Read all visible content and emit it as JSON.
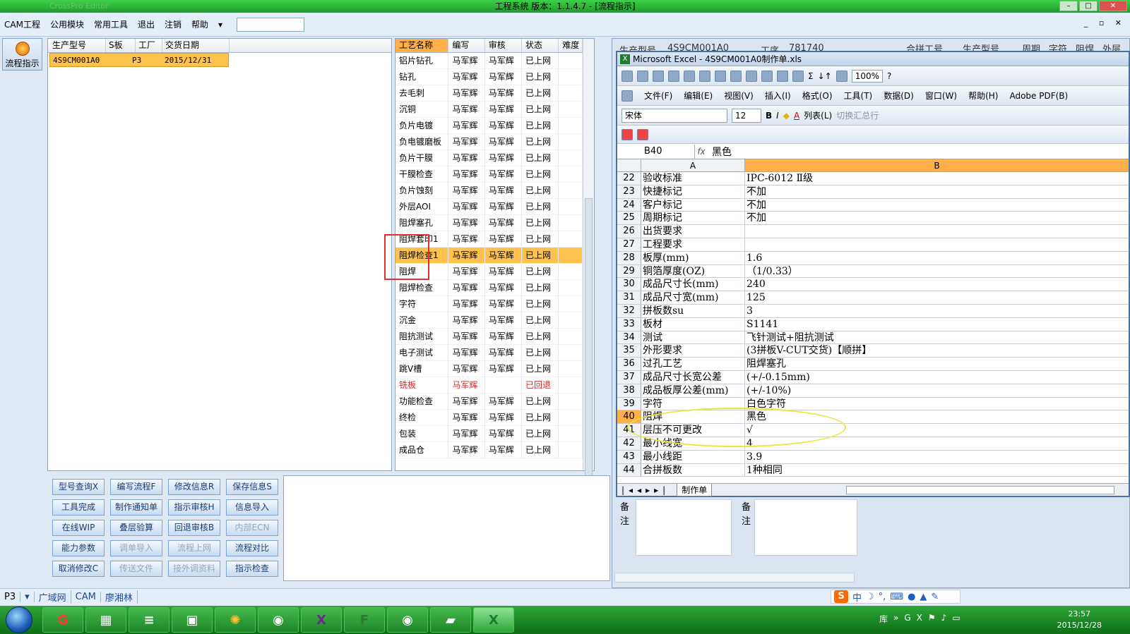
{
  "window": {
    "title": "工程系统   版本：1.1.4.7 - [流程指示]"
  },
  "menu": {
    "items": [
      "CAM工程",
      "公用模块",
      "常用工具",
      "退出",
      "注销",
      "帮助"
    ]
  },
  "flow_button": {
    "label": "流程指示"
  },
  "left_table": {
    "headers": [
      "生产型号",
      "S板",
      "工厂",
      "交货日期"
    ],
    "rows": [
      [
        "4S9CM001A0",
        "",
        "P3",
        "2015/12/31"
      ]
    ]
  },
  "process_table": {
    "headers": [
      "工艺名称",
      "编写",
      "审核",
      "状态",
      "难度"
    ],
    "rows": [
      [
        "铝片钻孔",
        "马军辉",
        "马军辉",
        "已上网",
        ""
      ],
      [
        "钻孔",
        "马军辉",
        "马军辉",
        "已上网",
        ""
      ],
      [
        "去毛刺",
        "马军辉",
        "马军辉",
        "已上网",
        ""
      ],
      [
        "沉铜",
        "马军辉",
        "马军辉",
        "已上网",
        ""
      ],
      [
        "负片电镀",
        "马军辉",
        "马军辉",
        "已上网",
        ""
      ],
      [
        "负电镀磨板",
        "马军辉",
        "马军辉",
        "已上网",
        ""
      ],
      [
        "负片干膜",
        "马军辉",
        "马军辉",
        "已上网",
        ""
      ],
      [
        "干膜检查",
        "马军辉",
        "马军辉",
        "已上网",
        ""
      ],
      [
        "负片蚀刻",
        "马军辉",
        "马军辉",
        "已上网",
        ""
      ],
      [
        "外层AOI",
        "马军辉",
        "马军辉",
        "已上网",
        ""
      ],
      [
        "阻焊塞孔",
        "马军辉",
        "马军辉",
        "已上网",
        ""
      ],
      [
        "阻焊套印1",
        "马军辉",
        "马军辉",
        "已上网",
        ""
      ],
      [
        "阻焊检查1",
        "马军辉",
        "马军辉",
        "已上网",
        ""
      ],
      [
        "阻焊",
        "马军辉",
        "马军辉",
        "已上网",
        ""
      ],
      [
        "阻焊检查",
        "马军辉",
        "马军辉",
        "已上网",
        ""
      ],
      [
        "字符",
        "马军辉",
        "马军辉",
        "已上网",
        ""
      ],
      [
        "沉金",
        "马军辉",
        "马军辉",
        "已上网",
        ""
      ],
      [
        "阻抗测试",
        "马军辉",
        "马军辉",
        "已上网",
        ""
      ],
      [
        "电子测试",
        "马军辉",
        "马军辉",
        "已上网",
        ""
      ],
      [
        "跳V槽",
        "马军辉",
        "马军辉",
        "已上网",
        ""
      ],
      [
        "铣板",
        "马军辉",
        "",
        "已回退",
        ""
      ],
      [
        "功能检查",
        "马军辉",
        "马军辉",
        "已上网",
        ""
      ],
      [
        "终检",
        "马军辉",
        "马军辉",
        "已上网",
        ""
      ],
      [
        "包装",
        "马军辉",
        "马军辉",
        "已上网",
        ""
      ],
      [
        "成品仓",
        "马军辉",
        "马军辉",
        "已上网",
        ""
      ]
    ]
  },
  "buttons": [
    [
      "型号查询X",
      "编写流程F",
      "修改信息R",
      "保存信息S"
    ],
    [
      "工具完成",
      "制作通知单",
      "指示审核H",
      "信息导入"
    ],
    [
      "在线WIP",
      "叠层验算",
      "回退审核B",
      "内部ECN"
    ],
    [
      "能力参数",
      "调单导入",
      "流程上网",
      "流程对比"
    ],
    [
      "取消修改C",
      "传送文件",
      "接外调资料",
      "指示检查"
    ]
  ],
  "status_bar": {
    "combo": "P3",
    "items": [
      "广域网",
      "CAM",
      "廖湘林"
    ]
  },
  "bg_window": {
    "labels": [
      "生产型号",
      "4S9CM001A0",
      "工序",
      "781740",
      "合拼工号",
      "生产型号",
      "周期",
      "字符",
      "阻焊",
      "外层"
    ],
    "note_label_1": "备注",
    "note_label_2": "备注"
  },
  "excel": {
    "title": "Microsoft Excel - 4S9CM001A0制作单.xls",
    "menu": [
      "文件(F)",
      "编辑(E)",
      "视图(V)",
      "插入(I)",
      "格式(O)",
      "工具(T)",
      "数据(D)",
      "窗口(W)",
      "帮助(H)",
      "Adobe PDF(B)"
    ],
    "zoom": "100%",
    "font": "宋体",
    "font_size": "12",
    "toolbar_items": [
      "列表(L)",
      "切换汇总行"
    ],
    "name_box": "B40",
    "formula_value": "黑色",
    "col_a": "A",
    "col_b": "B",
    "sheet_tab": "制作单",
    "rows": [
      [
        "22",
        "验收标准",
        "IPC-6012 Ⅱ级"
      ],
      [
        "23",
        "快捷标记",
        "不加"
      ],
      [
        "24",
        "客户标记",
        "不加"
      ],
      [
        "25",
        "周期标记",
        "不加"
      ],
      [
        "26",
        "出货要求",
        ""
      ],
      [
        "27",
        "工程要求",
        ""
      ],
      [
        "28",
        "板厚(mm)",
        "1.6"
      ],
      [
        "29",
        "铜箔厚度(OZ)",
        "（1/0.33）"
      ],
      [
        "30",
        "成品尺寸长(mm)",
        "240"
      ],
      [
        "31",
        "成品尺寸宽(mm)",
        "125"
      ],
      [
        "32",
        "拼板数su",
        "3"
      ],
      [
        "33",
        "板材",
        "S1141"
      ],
      [
        "34",
        "测试",
        "飞针测试+阻抗测试"
      ],
      [
        "35",
        "外形要求",
        "(3拼板V-CUT交货)【顺拼】"
      ],
      [
        "36",
        "过孔工艺",
        "阻焊塞孔"
      ],
      [
        "37",
        "成品尺寸长宽公差",
        "(+/-0.15mm)"
      ],
      [
        "38",
        "成品板厚公差(mm)",
        "(+/-10%)"
      ],
      [
        "39",
        "字符",
        "白色字符"
      ],
      [
        "40",
        "阻焊",
        "黑色"
      ],
      [
        "41",
        "层压不可更改",
        "√"
      ],
      [
        "42",
        "最小线宽",
        "4"
      ],
      [
        "43",
        "最小线距",
        "3.9"
      ],
      [
        "44",
        "合拼板数",
        "1种相同"
      ]
    ]
  },
  "taskbar": {
    "time": "23:57",
    "date": "2015/12/28",
    "tray_label": "库"
  }
}
